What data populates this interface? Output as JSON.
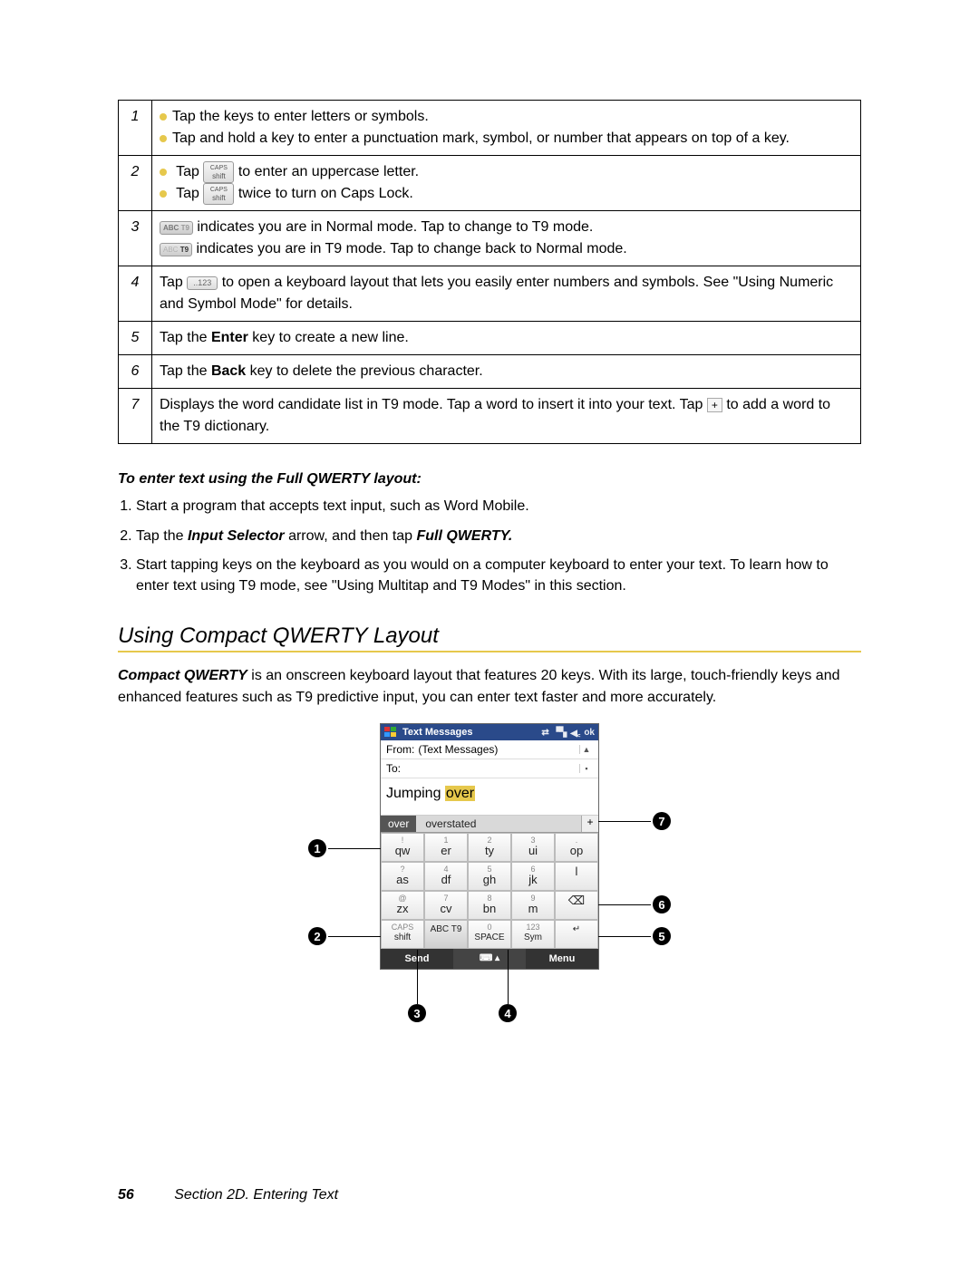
{
  "table": {
    "r1": {
      "n": "1",
      "a": "Tap the keys to enter letters or symbols.",
      "b": "Tap and hold a key to enter a punctuation mark, symbol, or number that appears on top of a key."
    },
    "r2": {
      "n": "2",
      "a1": "Tap",
      "a2": "to enter an uppercase letter.",
      "b1": "Tap",
      "b2": "twice to turn on Caps Lock.",
      "cap_top": "CAPS",
      "cap_bot": "shift"
    },
    "r3": {
      "n": "3",
      "a": "indicates you are in Normal mode. Tap to change to T9 mode.",
      "b": "indicates you are in T9 mode. Tap to change back to Normal mode.",
      "mode_abc": "ABC",
      "mode_t9": "T9"
    },
    "r4": {
      "n": "4",
      "a1": "Tap",
      "a2": "to open a keyboard layout that lets you easily enter numbers and symbols. See \"Using Numeric and Symbol Mode\" for details.",
      "sym": "..123"
    },
    "r5": {
      "n": "5",
      "a1": "Tap the ",
      "bold": "Enter",
      "a2": " key to create a new line."
    },
    "r6": {
      "n": "6",
      "a1": "Tap the ",
      "bold": "Back",
      "a2": " key to delete the previous character."
    },
    "r7": {
      "n": "7",
      "a1": "Displays the word candidate list in T9 mode. Tap a word to insert it into your text. Tap ",
      "a2": " to add a word to the T9 dictionary."
    }
  },
  "instr": {
    "head": "To enter text using the Full QWERTY layout:",
    "s1": "Start a program that accepts text input, such as Word Mobile.",
    "s2a": "Tap the ",
    "s2b": "Input Selector",
    "s2c": " arrow, and then tap ",
    "s2d": "Full QWERTY.",
    "s3": "Start tapping keys on the keyboard as you would on a computer keyboard to enter your text. To learn how to enter text using T9 mode, see \"Using Multitap and T9 Modes\" in this section."
  },
  "section_heading": "Using Compact QWERTY Layout",
  "para": {
    "bold": "Compact QWERTY",
    "rest": " is an onscreen keyboard layout that features 20 keys. With its large, touch-friendly keys and enhanced features such as T9 predictive input, you can enter text faster and more accurately."
  },
  "phone": {
    "title": "Text Messages",
    "ok": "ok",
    "from_label": "From:",
    "from_value": "(Text Messages)",
    "to_label": "To:",
    "typed_word": "Jumping ",
    "cursor_word": "over",
    "cand_sel": "over",
    "cand_other": "overstated",
    "plus": "+",
    "rows": [
      [
        {
          "s": "!",
          "m": "qw"
        },
        {
          "s": "1",
          "m": "er"
        },
        {
          "s": "2",
          "m": "ty"
        },
        {
          "s": "3",
          "m": "ui"
        },
        {
          "s": ".",
          "m": "op"
        }
      ],
      [
        {
          "s": "?",
          "m": "as"
        },
        {
          "s": "4",
          "m": "df"
        },
        {
          "s": "5",
          "m": "gh"
        },
        {
          "s": "6",
          "m": "jk"
        },
        {
          "s": "",
          "m": "l"
        }
      ],
      [
        {
          "s": "@",
          "m": "zx"
        },
        {
          "s": "7",
          "m": "cv"
        },
        {
          "s": "8",
          "m": "bn"
        },
        {
          "s": "9",
          "m": "m"
        },
        {
          "s": "",
          "m": "⌫"
        }
      ],
      [
        {
          "s": "CAPS",
          "m": "shift"
        },
        {
          "s": "",
          "m": "ABC T9"
        },
        {
          "s": "0",
          "m": "SPACE"
        },
        {
          "s": "123",
          "m": "Sym"
        },
        {
          "s": "",
          "m": "↵"
        }
      ]
    ],
    "send": "Send",
    "menu": "Menu"
  },
  "callouts": {
    "c1": "1",
    "c2": "2",
    "c3": "3",
    "c4": "4",
    "c5": "5",
    "c6": "6",
    "c7": "7"
  },
  "footer": {
    "page": "56",
    "section": "Section 2D. Entering Text"
  }
}
